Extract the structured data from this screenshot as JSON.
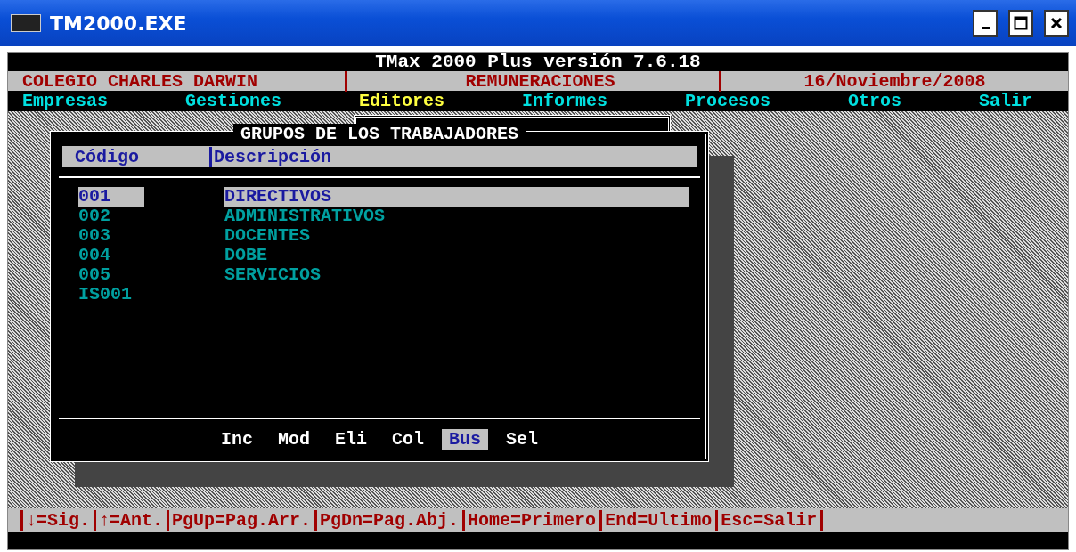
{
  "window": {
    "title": "TM2000.EXE"
  },
  "header": {
    "title": "TMax 2000 Plus versión 7.6.18",
    "company": "COLEGIO CHARLES DARWIN",
    "module": "REMUNERACIONES",
    "date": "16/Noviembre/2008"
  },
  "menu": [
    {
      "label": "Empresas",
      "selected": false
    },
    {
      "label": "Gestiones",
      "selected": false
    },
    {
      "label": "Editores",
      "selected": true
    },
    {
      "label": "Informes",
      "selected": false
    },
    {
      "label": "Procesos",
      "selected": false
    },
    {
      "label": "Otros",
      "selected": false
    },
    {
      "label": "Salir",
      "selected": false
    }
  ],
  "dialog": {
    "title": "GRUPOS DE LOS TRABAJADORES",
    "columns": [
      "Código",
      "Descripción"
    ],
    "rows": [
      {
        "code": "001",
        "description": "DIRECTIVOS",
        "selected": true
      },
      {
        "code": "002",
        "description": "ADMINISTRATIVOS",
        "selected": false
      },
      {
        "code": "003",
        "description": "DOCENTES",
        "selected": false
      },
      {
        "code": "004",
        "description": "DOBE",
        "selected": false
      },
      {
        "code": "005",
        "description": "SERVICIOS",
        "selected": false
      },
      {
        "code": "IS001",
        "description": "",
        "selected": false
      }
    ],
    "actions": [
      {
        "label": "Inc",
        "selected": false
      },
      {
        "label": "Mod",
        "selected": false
      },
      {
        "label": "Eli",
        "selected": false
      },
      {
        "label": "Col",
        "selected": false
      },
      {
        "label": "Bus",
        "selected": true
      },
      {
        "label": "Sel",
        "selected": false
      }
    ]
  },
  "status_bar": [
    "↓=Sig.",
    "↑=Ant.",
    "PgUp=Pag.Arr.",
    "PgDn=Pag.Abj.",
    "Home=Primero",
    "End=Ultimo",
    "Esc=Salir"
  ]
}
